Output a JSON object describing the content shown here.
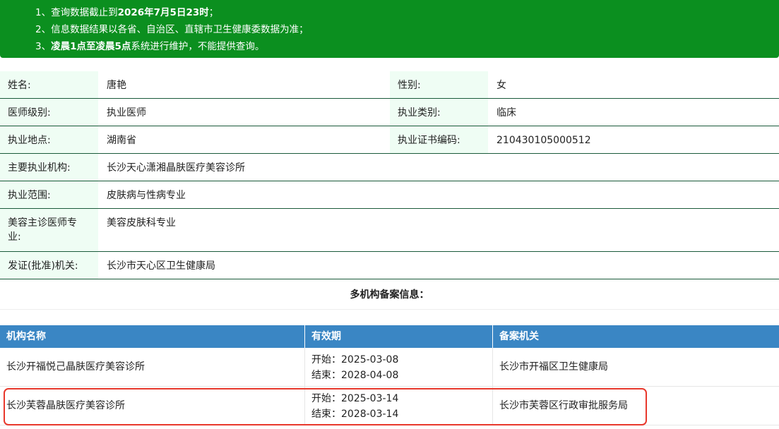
{
  "notice": {
    "line1_prefix": "1、查询数据截止到",
    "line1_bold": "2026年7月5日23时",
    "line1_suffix": "；",
    "line2": "2、信息数据结果以各省、自治区、直辖市卫生健康委数据为准；",
    "line3_prefix": "3、",
    "line3_bold": "凌晨1点至凌晨5点",
    "line3_suffix": "系统进行维护，不能提供查询。"
  },
  "doctor": {
    "name_label": "姓名:",
    "name": "唐艳",
    "gender_label": "性别:",
    "gender": "女",
    "level_label": "医师级别:",
    "level": "执业医师",
    "category_label": "执业类别:",
    "category": "临床",
    "location_label": "执业地点:",
    "location": "湖南省",
    "cert_label": "执业证书编码:",
    "cert": "210430105000512",
    "institution_label": "主要执业机构:",
    "institution": "长沙天心潇湘晶肤医疗美容诊所",
    "scope_label": "执业范围:",
    "scope": "皮肤病与性病专业",
    "cosmetic_label": "美容主诊医师专业:",
    "cosmetic": "美容皮肤科专业",
    "issuer_label": "发证(批准)机关:",
    "issuer": "长沙市天心区卫生健康局"
  },
  "multi": {
    "title": "多机构备案信息：",
    "headers": {
      "name": "机构名称",
      "validity": "有效期",
      "authority": "备案机关"
    },
    "rows": [
      {
        "name": "长沙开福悦己晶肤医疗美容诊所",
        "start": "开始：2025-03-08",
        "end": "结束：2028-04-08",
        "authority": "长沙市开福区卫生健康局"
      },
      {
        "name": "长沙芙蓉晶肤医疗美容诊所",
        "start": "开始：2025-03-14",
        "end": "结束：2028-03-14",
        "authority": "长沙市芙蓉区行政审批服务局"
      }
    ]
  },
  "colors": {
    "notice_bg": "#0b8f1f",
    "label_bg": "#effdf4",
    "table_header_bg": "#3a86c4",
    "highlight_border": "#e8382c"
  }
}
